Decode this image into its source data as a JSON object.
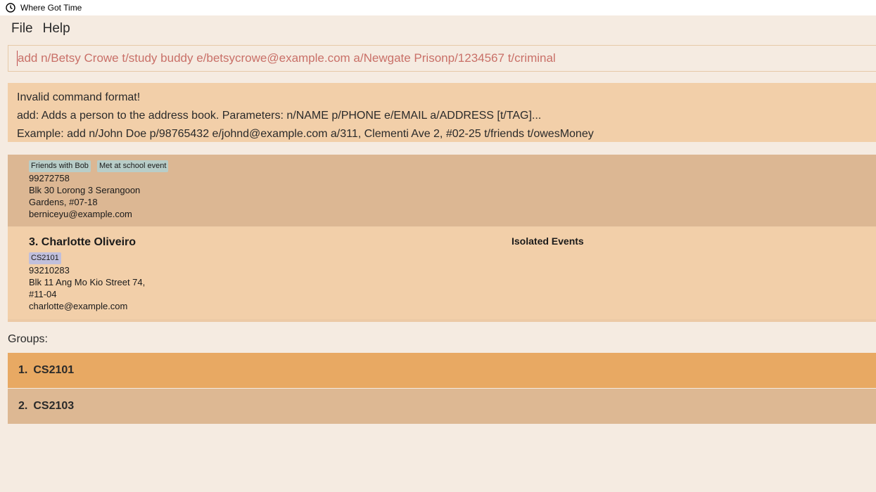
{
  "window": {
    "title": "Where Got Time",
    "icon": "clock-icon"
  },
  "menu": {
    "items": [
      "File",
      "Help"
    ]
  },
  "command": {
    "value": "add n/Betsy Crowe t/study buddy e/betsycrowe@example.com a/Newgate Prisonp/1234567 t/criminal"
  },
  "result": {
    "lines": [
      "Invalid command format!",
      "add: Adds a person to the address book. Parameters: n/NAME p/PHONE e/EMAIL a/ADDRESS [t/TAG]...",
      "Example: add n/John Doe p/98765432 e/johnd@example.com a/311, Clementi Ave 2, #02-25 t/friends t/owesMoney"
    ]
  },
  "persons": [
    {
      "tags": [
        "Friends with Bob",
        "Met at school event"
      ],
      "phone": "99272758",
      "address_lines": [
        "Blk 30 Lorong 3 Serangoon",
        "Gardens, #07-18"
      ],
      "email": "berniceyu@example.com"
    },
    {
      "name": "3. Charlotte Oliveiro",
      "tags": [
        "CS2101"
      ],
      "phone": "93210283",
      "address_lines": [
        "Blk 11 Ang Mo Kio Street 74,",
        "#11-04"
      ],
      "email": "charlotte@example.com",
      "events_heading": "Isolated Events"
    }
  ],
  "groups": {
    "label": "Groups:",
    "items": [
      {
        "index": "1.",
        "name": "CS2101"
      },
      {
        "index": "2.",
        "name": "CS2103"
      }
    ]
  },
  "colors": {
    "background": "#f5ebe1",
    "result_bg": "#f2cfa9",
    "card_alt_bg": "#dcb793",
    "group_selected": "#e8a963",
    "group_unselected": "#ddb893",
    "command_text": "#c97068"
  }
}
